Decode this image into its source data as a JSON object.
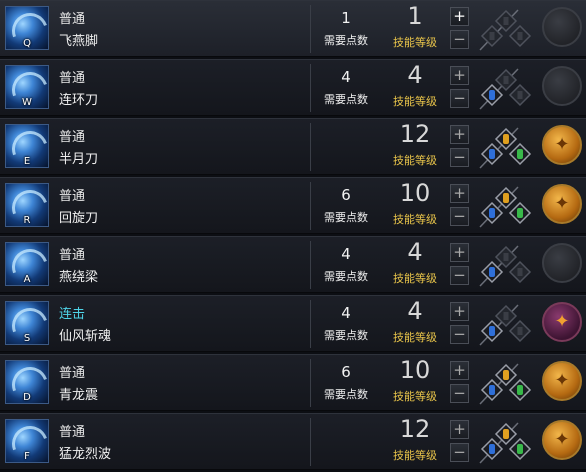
{
  "rows": [
    {
      "icon": "skill-icon-feiyanjiao",
      "key": "Q",
      "type": "普通",
      "name": "飞燕脚",
      "points": "1",
      "points_label": "需要点数",
      "level": "1",
      "level_label": "技能等级",
      "plus": "+",
      "minus": "−",
      "runes": {
        "I": false,
        "II": false,
        "III": false
      },
      "ult": "empty"
    },
    {
      "icon": "skill-icon-lianhuandao",
      "key": "W",
      "type": "普通",
      "name": "连环刀",
      "points": "4",
      "points_label": "需要点数",
      "level": "4",
      "level_label": "技能等级",
      "plus": "+",
      "minus": "−",
      "runes": {
        "I": true,
        "II": false,
        "III": false
      },
      "ult": "empty"
    },
    {
      "icon": "skill-icon-banyuedao",
      "key": "E",
      "type": "普通",
      "name": "半月刀",
      "points": "",
      "points_label": "",
      "level": "12",
      "level_label": "技能等级",
      "plus": "+",
      "minus": "−",
      "runes": {
        "I": true,
        "II": true,
        "III": true
      },
      "ult": "gold"
    },
    {
      "icon": "skill-icon-huixuandao",
      "key": "R",
      "type": "普通",
      "name": "回旋刀",
      "points": "6",
      "points_label": "需要点数",
      "level": "10",
      "level_label": "技能等级",
      "plus": "+",
      "minus": "−",
      "runes": {
        "I": true,
        "II": true,
        "III": true
      },
      "ult": "gold"
    },
    {
      "icon": "skill-icon-yanraoliang",
      "key": "A",
      "type": "普通",
      "name": "燕绕梁",
      "points": "4",
      "points_label": "需要点数",
      "level": "4",
      "level_label": "技能等级",
      "plus": "+",
      "minus": "−",
      "runes": {
        "I": true,
        "II": false,
        "III": false
      },
      "ult": "empty"
    },
    {
      "icon": "skill-icon-xianfengzhanhun",
      "key": "S",
      "type": "连击",
      "name": "仙风斩魂",
      "points": "4",
      "points_label": "需要点数",
      "level": "4",
      "level_label": "技能等级",
      "plus": "+",
      "minus": "−",
      "runes": {
        "I": true,
        "II": false,
        "III": false
      },
      "ult": "purple"
    },
    {
      "icon": "skill-icon-qinglongzhen",
      "key": "D",
      "type": "普通",
      "name": "青龙震",
      "points": "6",
      "points_label": "需要点数",
      "level": "10",
      "level_label": "技能等级",
      "plus": "+",
      "minus": "−",
      "runes": {
        "I": true,
        "II": true,
        "III": true
      },
      "ult": "gold"
    },
    {
      "icon": "skill-icon-menglonglie",
      "key": "F",
      "type": "普通",
      "name": "猛龙烈波",
      "points": "",
      "points_label": "",
      "level": "12",
      "level_label": "技能等级",
      "plus": "+",
      "minus": "−",
      "runes": {
        "I": true,
        "II": true,
        "III": true
      },
      "ult": "gold"
    }
  ],
  "colors": {
    "rune_I": "#2f6fd8",
    "rune_II": "#38b84a",
    "rune_III": "#e0a020",
    "level_label": "#e8c44a",
    "combo_type": "#4fd4e8"
  }
}
